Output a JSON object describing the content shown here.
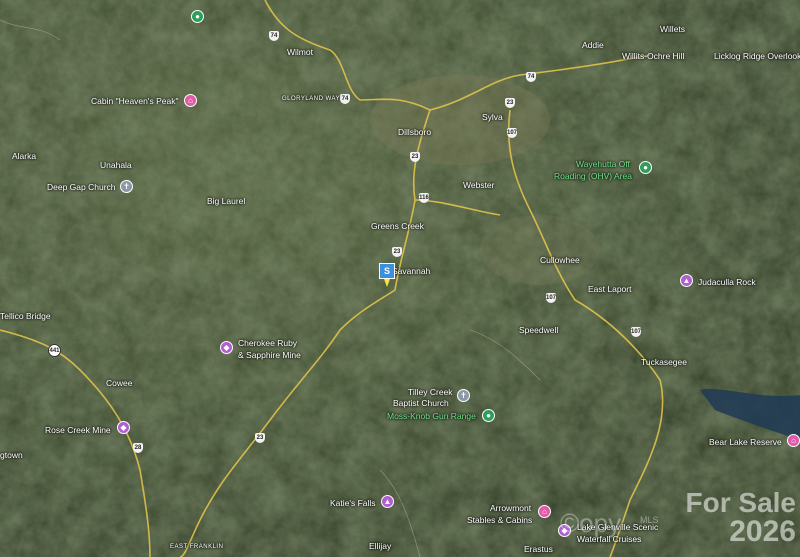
{
  "map": {
    "towns": [
      {
        "name": "Willets"
      },
      {
        "name": "Addie"
      },
      {
        "name": "Willits-Ochre Hill"
      },
      {
        "name": "Licklog Ridge Overlook"
      },
      {
        "name": "Wilmot"
      },
      {
        "name": "Dillsboro"
      },
      {
        "name": "Sylva"
      },
      {
        "name": "Alarka"
      },
      {
        "name": "Unahala"
      },
      {
        "name": "Webster"
      },
      {
        "name": "Big Laurel"
      },
      {
        "name": "Greens Creek"
      },
      {
        "name": "Savannah"
      },
      {
        "name": "Cullowhee"
      },
      {
        "name": "East Laport"
      },
      {
        "name": "Tellico Bridge"
      },
      {
        "name": "Speedwell"
      },
      {
        "name": "Cowee"
      },
      {
        "name": "Tuckasegee"
      },
      {
        "name": "Rose Creek Mine"
      },
      {
        "name": "gtown"
      },
      {
        "name": "Bear Lake Reserve"
      },
      {
        "name": "Ellijay"
      },
      {
        "name": "Erastus"
      }
    ],
    "pois": [
      {
        "name": "Cabin \"Heaven's Peak\"",
        "icon": "lodging-icon",
        "color": "#e05aa8"
      },
      {
        "name": "Deep Gap Church",
        "icon": "church-icon",
        "color": "#8a98a8"
      },
      {
        "name": "Wayehutta Off Roading (OHV) Area",
        "icon": "park-icon",
        "color": "#2e9e5a"
      },
      {
        "name": "Judaculla Rock",
        "icon": "landmark-icon",
        "color": "#b25fd0"
      },
      {
        "name": "Cherokee Ruby & Sapphire Mine",
        "icon": "attraction-icon",
        "color": "#b25fd0"
      },
      {
        "name": "Tilley Creek Baptist Church",
        "icon": "church-icon",
        "color": "#8a98a8"
      },
      {
        "name": "Moss-Knob Gun Range",
        "icon": "park-icon",
        "color": "#2e9e5a"
      },
      {
        "name": "Rose Creek Mine",
        "icon": "attraction-icon",
        "color": "#b25fd0"
      },
      {
        "name": "Katie's Falls",
        "icon": "landmark-icon",
        "color": "#b25fd0"
      },
      {
        "name": "Arrowmont Stables & Cabins",
        "icon": "lodging-icon",
        "color": "#e05aa8"
      },
      {
        "name": "Lake Glenville Scenic Waterfall Cruises",
        "icon": "attraction-icon",
        "color": "#b25fd0"
      }
    ],
    "area_labels": [
      "GLORYLAND WAY",
      "EAST FRANKLIN"
    ],
    "route_shields": [
      "74",
      "74",
      "74",
      "23",
      "23",
      "23",
      "107",
      "107",
      "107",
      "116",
      "441",
      "28",
      "23"
    ],
    "subject_marker": "S",
    "watermark": {
      "line1": "For Sale",
      "line2": "2026",
      "copy": "©opy",
      "mls": "MLS"
    },
    "colors": {
      "terrain": "#3a4a2e",
      "road": "#e8c84a",
      "water": "#1e3a55"
    }
  }
}
